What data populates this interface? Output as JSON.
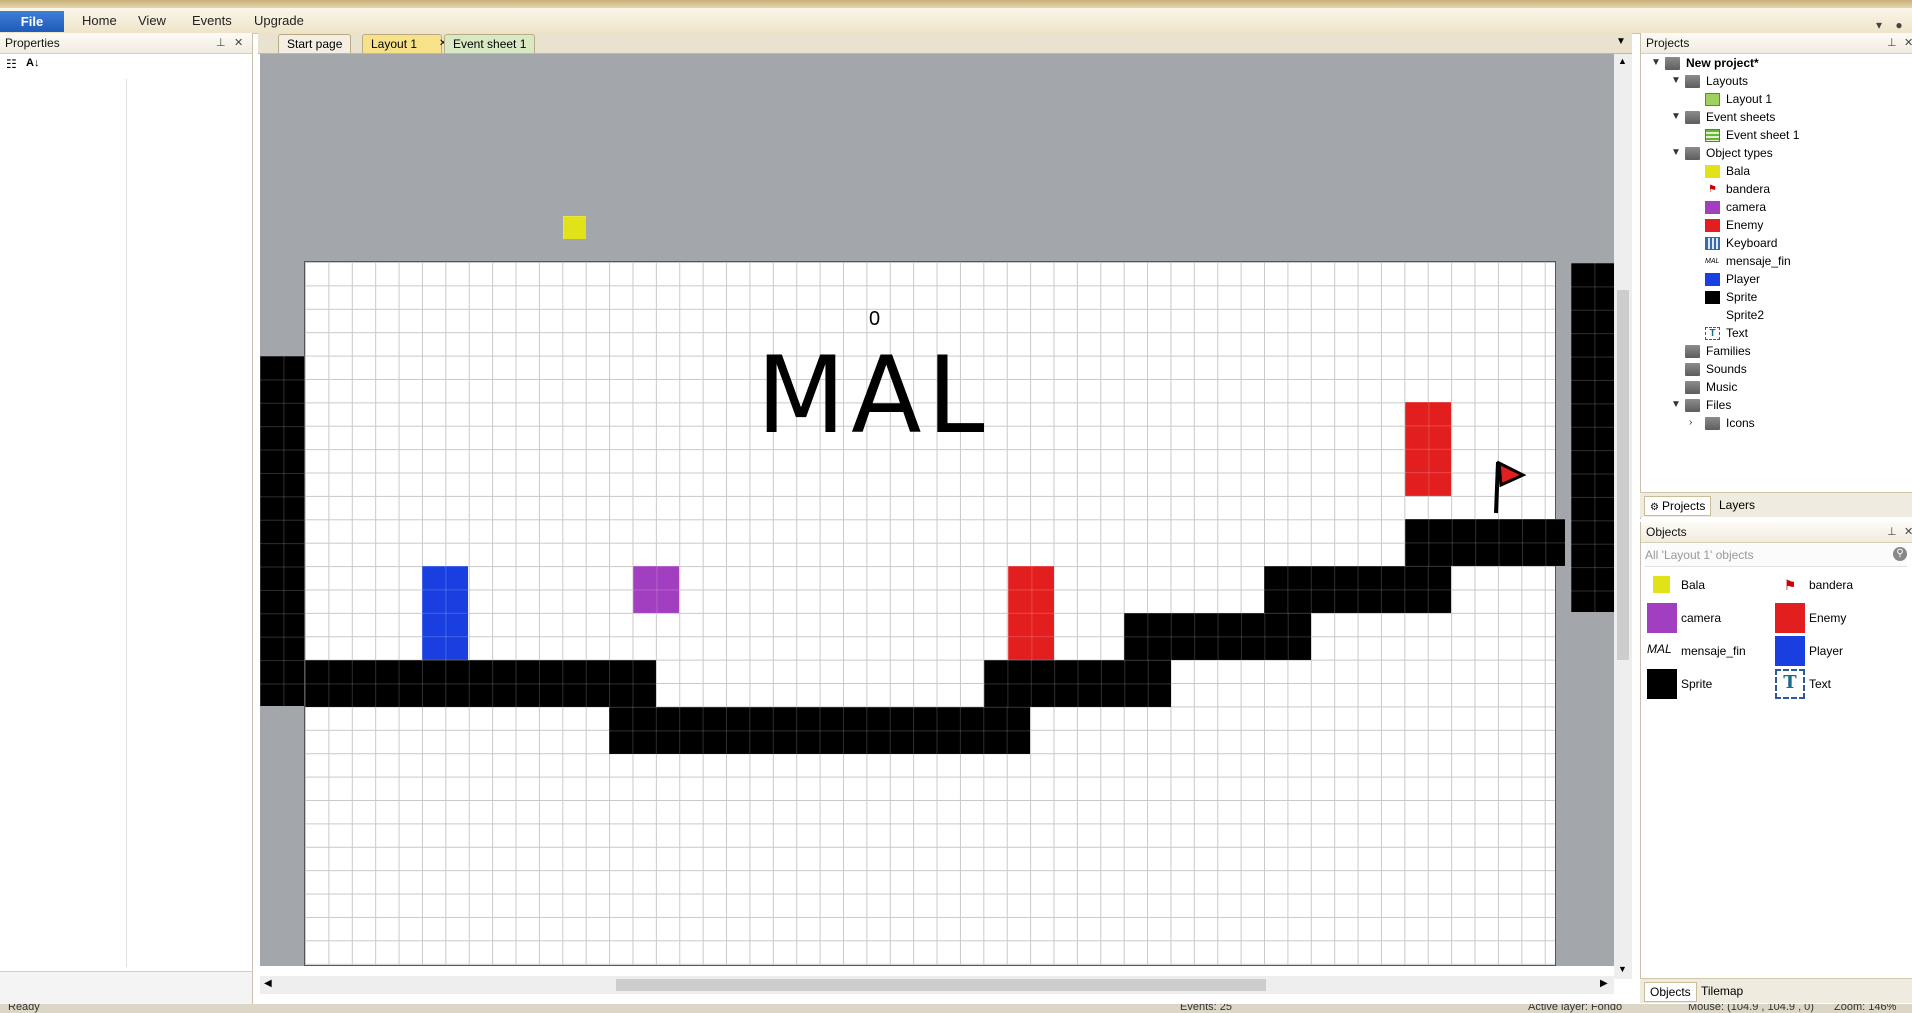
{
  "ribbon": {
    "file": "File",
    "menus": [
      "Home",
      "View",
      "Events",
      "Upgrade"
    ]
  },
  "properties": {
    "title": "Properties"
  },
  "tabs": [
    {
      "label": "Start page"
    },
    {
      "label": "Layout 1"
    },
    {
      "label": "Event sheet 1"
    }
  ],
  "layout": {
    "score_text": "0",
    "message_text": "MAL"
  },
  "projects": {
    "title": "Projects",
    "root": "New project*",
    "layouts": "Layouts",
    "layout1": "Layout 1",
    "event_sheets": "Event sheets",
    "event_sheet1": "Event sheet 1",
    "object_types": "Object types",
    "types": [
      "Bala",
      "bandera",
      "camera",
      "Enemy",
      "Keyboard",
      "mensaje_fin",
      "Player",
      "Sprite",
      "Sprite2",
      "Text"
    ],
    "families": "Families",
    "sounds": "Sounds",
    "music": "Music",
    "files": "Files",
    "icons": "Icons",
    "bottom_tabs": [
      "Projects",
      "Layers"
    ]
  },
  "objects": {
    "title": "Objects",
    "filter": "All 'Layout 1' objects",
    "items": [
      "Bala",
      "bandera",
      "camera",
      "Enemy",
      "mensaje_fin",
      "Player",
      "Sprite",
      "Text"
    ],
    "bottom_tabs": [
      "Objects",
      "Tilemap"
    ]
  },
  "status": {
    "ready": "Ready",
    "events": "Events: 25",
    "active_layer": "Active layer: Fondo",
    "mouse": "Mouse: (104.9 , 104.9 , 0)",
    "zoom": "Zoom: 146%"
  },
  "colors": {
    "enemy": "#e31e1e",
    "player": "#1a3fe0",
    "camera": "#a23fc0",
    "bala": "#e2e21a",
    "sprite": "#000000",
    "ribbon_accent": "#1f5bb8"
  }
}
